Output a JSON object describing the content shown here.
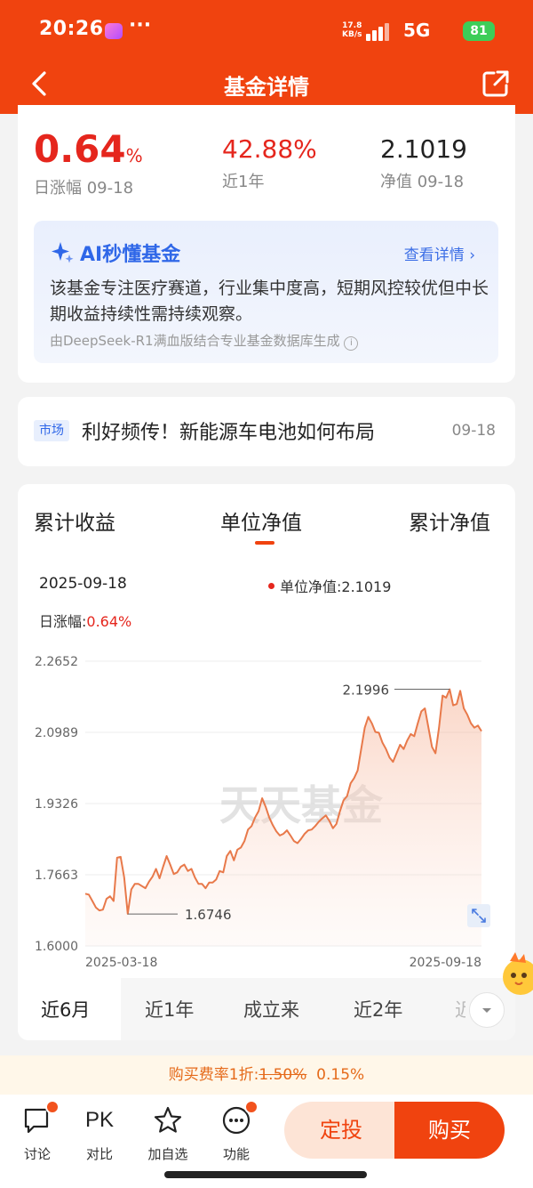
{
  "status_bar": {
    "time": "20:26",
    "more": "···",
    "speed": "17.8\nKB/s",
    "network": "5G",
    "battery": "81"
  },
  "nav": {
    "title": "基金详情"
  },
  "summary": {
    "daily_value": "0.64",
    "daily_unit": "%",
    "daily_label": "日涨幅 09-18",
    "year_value": "42.88%",
    "year_label": "近1年",
    "nav_value": "2.1019",
    "nav_label": "净值 09-18"
  },
  "ai": {
    "title": "AI秒懂基金",
    "detail": "查看详情",
    "body": "该基金专注医疗赛道，行业集中度高，短期风控较优但中长期收益持续性需持续观察。",
    "source": "由DeepSeek-R1满血版结合专业基金数据库生成"
  },
  "news": {
    "tag": "市场",
    "text": "利好频传！新能源车电池如何布局",
    "date": "09-18"
  },
  "chart_tabs": [
    "累计收益",
    "单位净值",
    "累计净值"
  ],
  "chart_info": {
    "date": "2025-09-18",
    "nav_label": "单位净值:",
    "nav_value": "2.1019",
    "day_label": "日涨幅:",
    "day_value": "0.64%"
  },
  "watermark": "天天基金",
  "ranges": [
    "近6月",
    "近1年",
    "成立来",
    "近2年",
    "近"
  ],
  "fee": {
    "prefix": "购买费率1折:",
    "old": "1.50%",
    "new": "0.15%"
  },
  "bottom": {
    "items": [
      "讨论",
      "对比",
      "加自选",
      "功能"
    ],
    "pk": "PK",
    "dingtou": "定投",
    "buy": "购买"
  },
  "colors": {
    "brand": "#f0430f",
    "up": "#e5261d",
    "line": "#e8794a",
    "ai_blue": "#2f67e8"
  },
  "chart_data": {
    "type": "area",
    "series": [
      {
        "name": "单位净值",
        "values": [
          1.722,
          1.72,
          1.705,
          1.69,
          1.683,
          1.685,
          1.71,
          1.716,
          1.705,
          1.806,
          1.808,
          1.76,
          1.675,
          1.732,
          1.745,
          1.745,
          1.74,
          1.735,
          1.75,
          1.762,
          1.78,
          1.758,
          1.785,
          1.81,
          1.79,
          1.768,
          1.772,
          1.785,
          1.79,
          1.775,
          1.78,
          1.76,
          1.745,
          1.745,
          1.735,
          1.748,
          1.748,
          1.755,
          1.775,
          1.772,
          1.81,
          1.822,
          1.8,
          1.825,
          1.83,
          1.845,
          1.872,
          1.88,
          1.9,
          1.915,
          1.945,
          1.925,
          1.9,
          1.882,
          1.868,
          1.858,
          1.862,
          1.87,
          1.858,
          1.845,
          1.84,
          1.85,
          1.862,
          1.87,
          1.872,
          1.88,
          1.89,
          1.898,
          1.905,
          1.892,
          1.875,
          1.885,
          1.915,
          1.94,
          1.95,
          1.98,
          1.992,
          2.01,
          2.06,
          2.11,
          2.135,
          2.12,
          2.1,
          2.098,
          2.075,
          2.06,
          2.04,
          2.03,
          2.05,
          2.07,
          2.06,
          2.08,
          2.095,
          2.09,
          2.12,
          2.148,
          2.155,
          2.11,
          2.065,
          2.05,
          2.11,
          2.185,
          2.18,
          2.1996,
          2.162,
          2.165,
          2.196,
          2.155,
          2.14,
          2.12,
          2.11,
          2.115,
          2.1019
        ],
        "x_start": "2025-03-18",
        "x_end": "2025-09-18"
      }
    ],
    "ylim": [
      1.6,
      2.2652
    ],
    "y_ticks": [
      "2.2652",
      "2.0989",
      "1.9326",
      "1.7663",
      "1.6000"
    ],
    "x_ticks": [
      "2025-03-18",
      "2025-09-18"
    ],
    "annotations": {
      "max": "2.1996",
      "min": "1.6746"
    },
    "grid": true
  }
}
